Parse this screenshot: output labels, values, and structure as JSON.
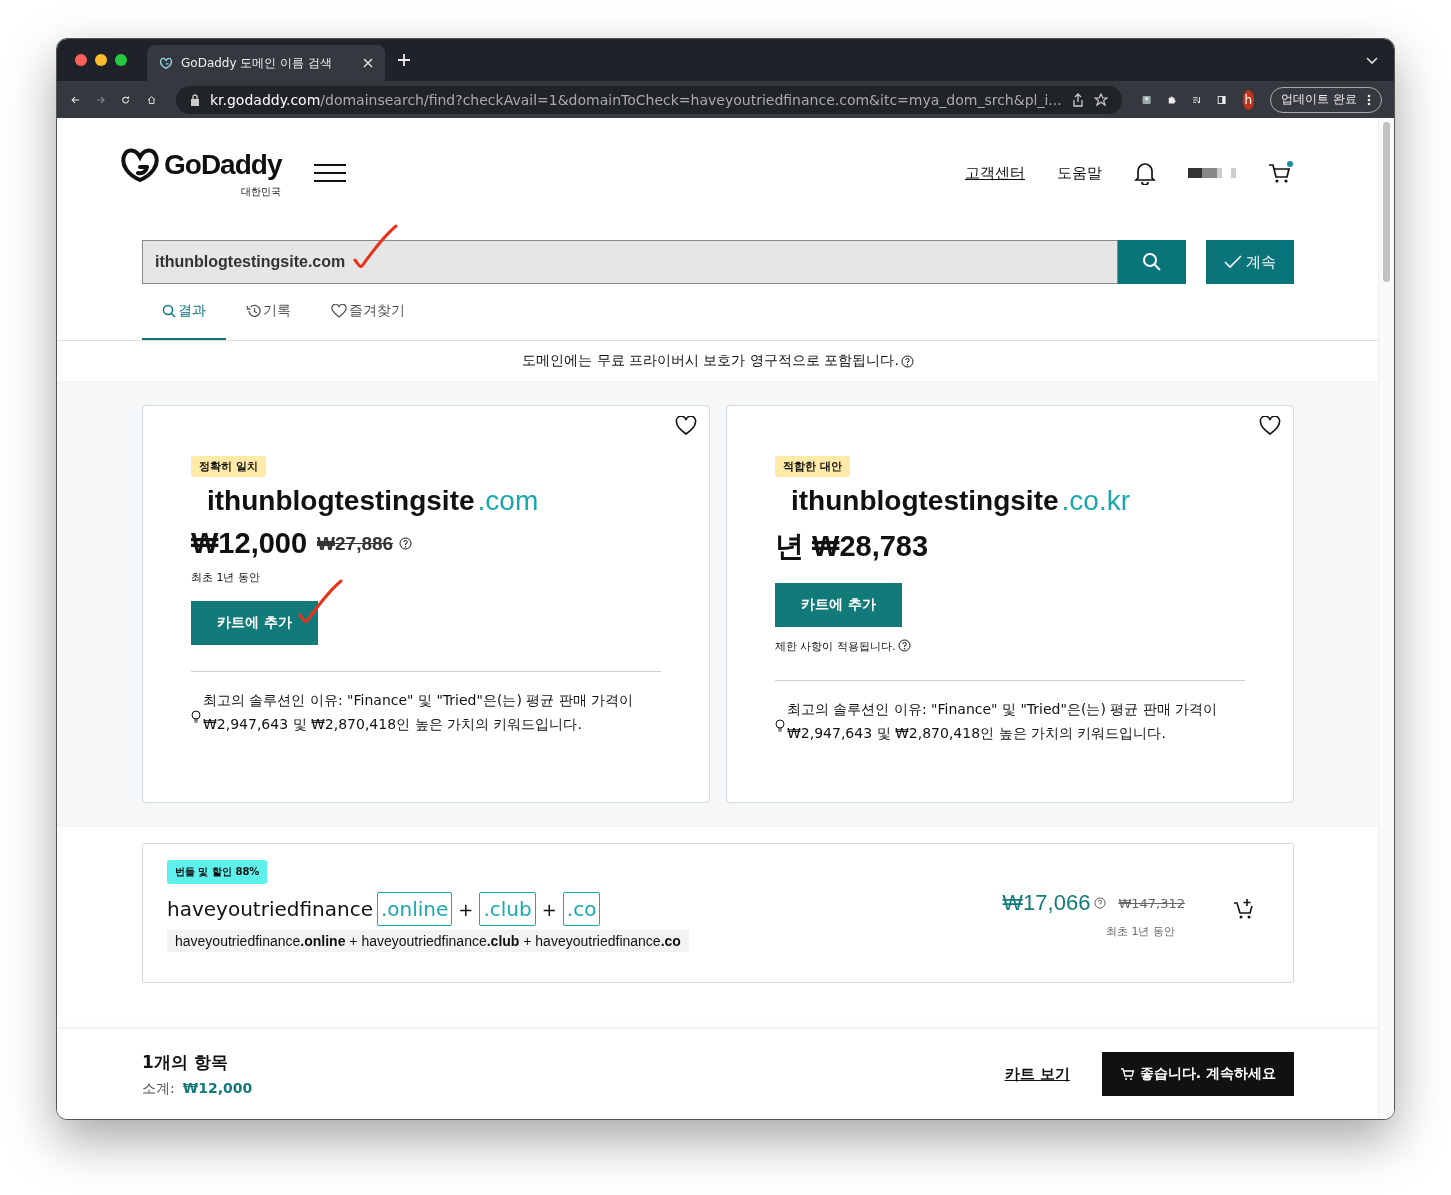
{
  "browser": {
    "tab_title": "GoDaddy 도메인 이름 검색",
    "url_host": "kr.godaddy.com",
    "url_path": "/domainsearch/find?checkAvail=1&domainToCheck=haveyoutriedfinance.com&itc=mya_dom_srch&pl_i...",
    "profile_initial": "h",
    "update_button": "업데이트 완료"
  },
  "header": {
    "logo": "GoDaddy",
    "logo_sub": "대한민국",
    "links": [
      {
        "label": "고객센터",
        "underlined": true
      },
      {
        "label": "도움말",
        "underlined": false
      }
    ]
  },
  "search": {
    "value": "ithunblogtestingsite.com",
    "continue_button": "계속"
  },
  "tabs": [
    {
      "label": "결과",
      "kind": "search",
      "selected": true
    },
    {
      "label": "기록",
      "kind": "history",
      "selected": false
    },
    {
      "label": "즐겨찾기",
      "kind": "heart",
      "selected": false
    }
  ],
  "privacy_note": "도메인에는 무료 프라이버시 보호가 영구적으로 포함됩니다.",
  "cards": [
    {
      "badge": "정확히 일치",
      "name": "ithunblogtestingsite",
      "tld": ".com",
      "price": "₩12,000",
      "old_price": "₩27,886",
      "term": "최초 1년 동안",
      "button": "카트에 추가",
      "tip": "최고의 솔루션인 이유: \"Finance\" 및 \"Tried\"은(는) 평균 판매 가격이 ₩2,947,643 및 ₩2,870,418인 높은 가치의 키워드입니다."
    },
    {
      "badge": "적합한 대안",
      "name": "ithunblogtestingsite",
      "tld": ".co.kr",
      "price": "년 ₩28,783",
      "button": "카트에 추가",
      "restriction": "제한 사항이 적용됩니다.",
      "tip": "최고의 솔루션인 이유: \"Finance\" 및 \"Tried\"은(는) 평균 판매 가격이 ₩2,947,643 및 ₩2,870,418인 높은 가치의 키워드입니다."
    }
  ],
  "bundle": {
    "badge": "번들 및 할인 88%",
    "name": "haveyoutriedfinance",
    "tlds": [
      {
        "tld": ".online",
        "joiner": "+"
      },
      {
        "tld": ".club",
        "joiner": "+"
      },
      {
        "tld": ".co"
      }
    ],
    "summary": "haveyoutriedfinance**.online** + haveyoutriedfinance**.club** + haveyoutriedfinance**.co**",
    "price": "₩17,066",
    "old_price": "₩147,312",
    "term": "최초 1년 동안"
  },
  "footer": {
    "count": "1개의 항목",
    "subtotal_label": "소계:",
    "subtotal": "₩12,000",
    "view_cart": "카트 보기",
    "checkout": "좋습니다. 계속하세요"
  }
}
